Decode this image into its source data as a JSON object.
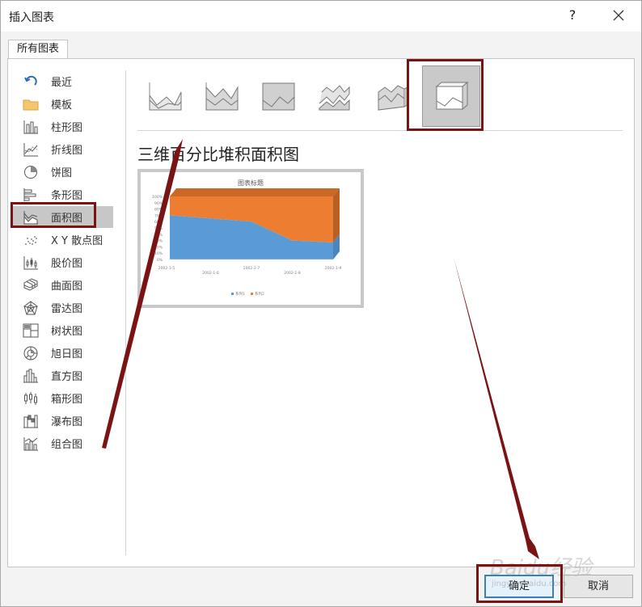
{
  "dialog": {
    "title": "插入图表",
    "help_label": "?"
  },
  "tabs": [
    {
      "label": "所有图表"
    }
  ],
  "sidebar": {
    "items": [
      {
        "label": "最近",
        "icon": "recent-icon"
      },
      {
        "label": "模板",
        "icon": "folder-icon"
      },
      {
        "label": "柱形图",
        "icon": "column-chart-icon"
      },
      {
        "label": "折线图",
        "icon": "line-chart-icon"
      },
      {
        "label": "饼图",
        "icon": "pie-chart-icon"
      },
      {
        "label": "条形图",
        "icon": "bar-chart-icon"
      },
      {
        "label": "面积图",
        "icon": "area-chart-icon",
        "selected": true
      },
      {
        "label": "X Y 散点图",
        "icon": "scatter-chart-icon"
      },
      {
        "label": "股价图",
        "icon": "stock-chart-icon"
      },
      {
        "label": "曲面图",
        "icon": "surface-chart-icon"
      },
      {
        "label": "雷达图",
        "icon": "radar-chart-icon"
      },
      {
        "label": "树状图",
        "icon": "treemap-chart-icon"
      },
      {
        "label": "旭日图",
        "icon": "sunburst-chart-icon"
      },
      {
        "label": "直方图",
        "icon": "histogram-chart-icon"
      },
      {
        "label": "箱形图",
        "icon": "box-whisker-chart-icon"
      },
      {
        "label": "瀑布图",
        "icon": "waterfall-chart-icon"
      },
      {
        "label": "组合图",
        "icon": "combo-chart-icon"
      }
    ]
  },
  "subtypes": [
    {
      "icon": "area-subtype-icon"
    },
    {
      "icon": "stacked-area-subtype-icon"
    },
    {
      "icon": "percent-stacked-area-subtype-icon"
    },
    {
      "icon": "3d-area-subtype-icon"
    },
    {
      "icon": "3d-stacked-area-subtype-icon"
    },
    {
      "icon": "3d-percent-stacked-area-subtype-icon",
      "selected": true
    }
  ],
  "selected_chart_name": "三维百分比堆积面积图",
  "preview": {
    "title": "图表标题",
    "y_ticks": [
      "100%",
      "90%",
      "80%",
      "70%",
      "60%",
      "50%",
      "40%",
      "30%",
      "20%",
      "10%",
      "0%"
    ],
    "x_ticks": [
      "2002-1-5",
      "2002-1-6",
      "2002-1-7",
      "2002-1-8",
      "2002-1-9"
    ],
    "legend": [
      "系列1",
      "系列2"
    ],
    "colors": {
      "series1": "#5b9bd5",
      "series2": "#ed7d31"
    }
  },
  "chart_data": {
    "type": "area",
    "title": "图表标题",
    "categories": [
      "2002-1-5",
      "2002-1-6",
      "2002-1-7",
      "2002-1-8",
      "2002-1-9"
    ],
    "series": [
      {
        "name": "系列1",
        "values": [
          0.7,
          0.65,
          0.6,
          0.3,
          0.27
        ]
      },
      {
        "name": "系列2",
        "values": [
          0.3,
          0.35,
          0.4,
          0.7,
          0.73
        ]
      }
    ],
    "ylim": [
      0,
      1
    ],
    "y_format": "percent",
    "legend": "bottom"
  },
  "buttons": {
    "ok": "确定",
    "cancel": "取消"
  },
  "watermark": {
    "logo": "Baidu经验",
    "url": "jingyan.baidu.com"
  },
  "annotation_color": "#7a1313"
}
